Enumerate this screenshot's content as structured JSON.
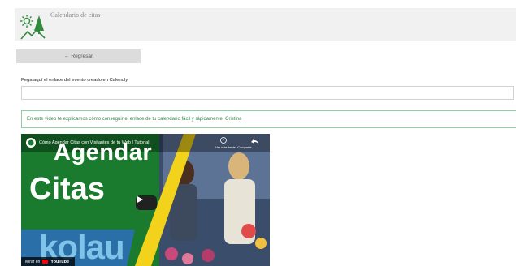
{
  "header": {
    "app_title": "Calendario de citas",
    "logo_icon": "sun-tree-mountain-logo"
  },
  "back_button": {
    "label": "Regresar",
    "icon": "arrow-left-icon"
  },
  "form": {
    "field_label": "Pega aquí el enlace del evento creado en Calendly",
    "field_value": "",
    "field_placeholder": ""
  },
  "info": {
    "text": "En este video te explicamos cómo conseguir el enlace de tu calendario fácil y rápidamente, Cristina",
    "border_color": "#8fd19e",
    "text_color": "#3a8a4a"
  },
  "video": {
    "title": "Cómo Agendar Citas con Visitantes de tu Web | Tutorial",
    "watch_later_label": "Ver más tarde",
    "share_label": "Compartir",
    "thumbnail_line1": "Agendar",
    "thumbnail_line2": "Citas",
    "thumbnail_brand": "kolau",
    "watch_on_label": "Mirar en",
    "platform": "YouTube",
    "brand_color": "#1a8a3a"
  }
}
